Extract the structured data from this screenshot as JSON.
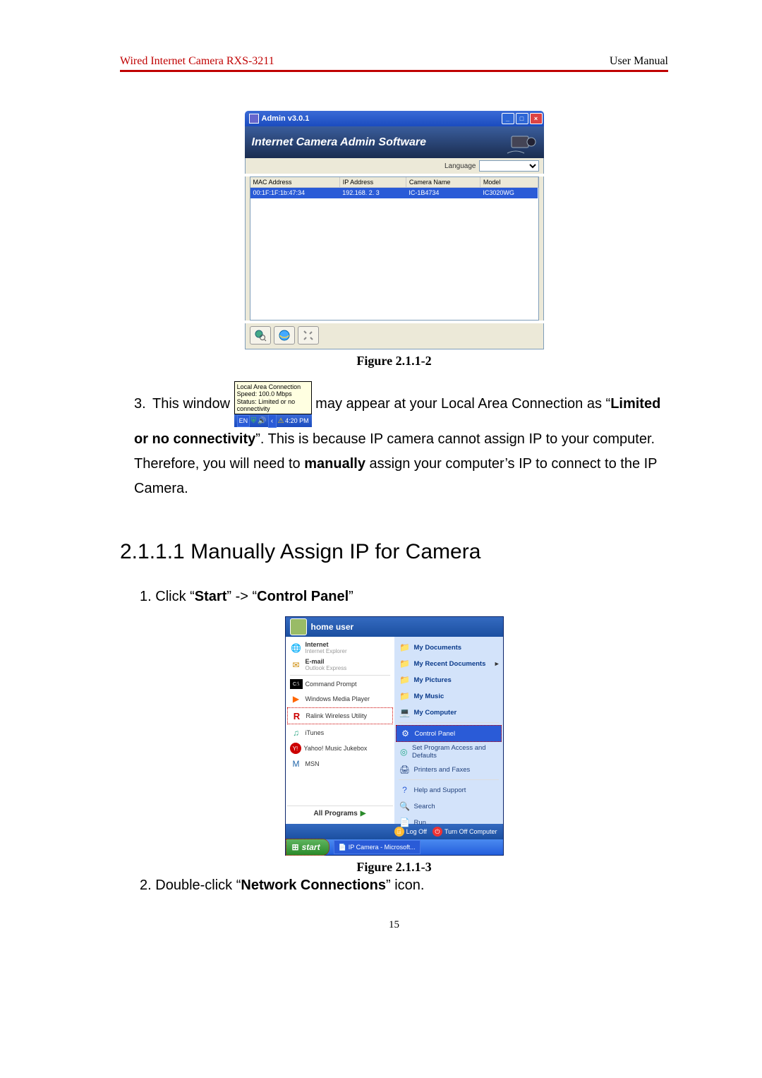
{
  "header": {
    "left": "Wired Internet Camera RXS-3211",
    "right": "User Manual"
  },
  "admin_window": {
    "title": "Admin v3.0.1",
    "banner_title": "Internet Camera Admin Software",
    "language_label": "Language",
    "columns": [
      "MAC Address",
      "IP Address",
      "Camera Name",
      "Model"
    ],
    "row": {
      "mac": "00:1F:1F:1b:47:34",
      "ip": "192.168.  2.  3",
      "cam": "IC-1B4734",
      "model": "IC3020WG"
    }
  },
  "figure1_caption": "Figure 2.1.1-2",
  "tooltip": {
    "line1": "Local Area Connection",
    "line2": "Speed: 100.0 Mbps",
    "line3": "Status: Limited or no connectivity",
    "lang": "EN",
    "time": "4:20 PM"
  },
  "step3": {
    "num": "3.",
    "lead": "This window ",
    "after": " may appear at your Local Area Connection as “",
    "bold1": "Limited or no connectivity",
    "mid": "”. This is because IP camera cannot assign IP to your computer. Therefore, you will need to ",
    "bold2": "manually",
    "tail": " assign your computer’s IP to connect to the IP Camera."
  },
  "heading": "2.1.1.1 Manually Assign IP for Camera",
  "step1": {
    "num": "1.",
    "pre": "Click “",
    "b1": "Start",
    "mid": "” -> “",
    "b2": "Control Panel",
    "post": "”"
  },
  "startmenu": {
    "user": "home user",
    "left": [
      {
        "title": "Internet",
        "sub": "Internet Explorer",
        "icon": "🌐"
      },
      {
        "title": "E-mail",
        "sub": "Outlook Express",
        "icon": "✉"
      },
      {
        "title": "Command Prompt",
        "icon": "■"
      },
      {
        "title": "Windows Media Player",
        "icon": "▶"
      },
      {
        "title": "Ralink Wireless Utility",
        "icon": "R"
      },
      {
        "title": "iTunes",
        "icon": "♫"
      },
      {
        "title": "Yahoo! Music Jukebox",
        "icon": "Y!"
      },
      {
        "title": "MSN",
        "icon": "M"
      }
    ],
    "all_programs": "All Programs",
    "right_top": [
      "My Documents",
      "My Recent Documents",
      "My Pictures",
      "My Music",
      "My Computer"
    ],
    "right_mid": [
      "Control Panel",
      "Set Program Access and Defaults",
      "Printers and Faxes"
    ],
    "right_bottom": [
      "Help and Support",
      "Search",
      "Run..."
    ],
    "logoff": "Log Off",
    "turnoff": "Turn Off Computer",
    "start_label": "start",
    "task_label": "IP Camera - Microsoft..."
  },
  "figure2_caption": "Figure 2.1.1-3",
  "step2": {
    "num": "2.",
    "pre": "Double-click “",
    "b": "Network Connections",
    "post": "” icon."
  },
  "page_number": "15"
}
